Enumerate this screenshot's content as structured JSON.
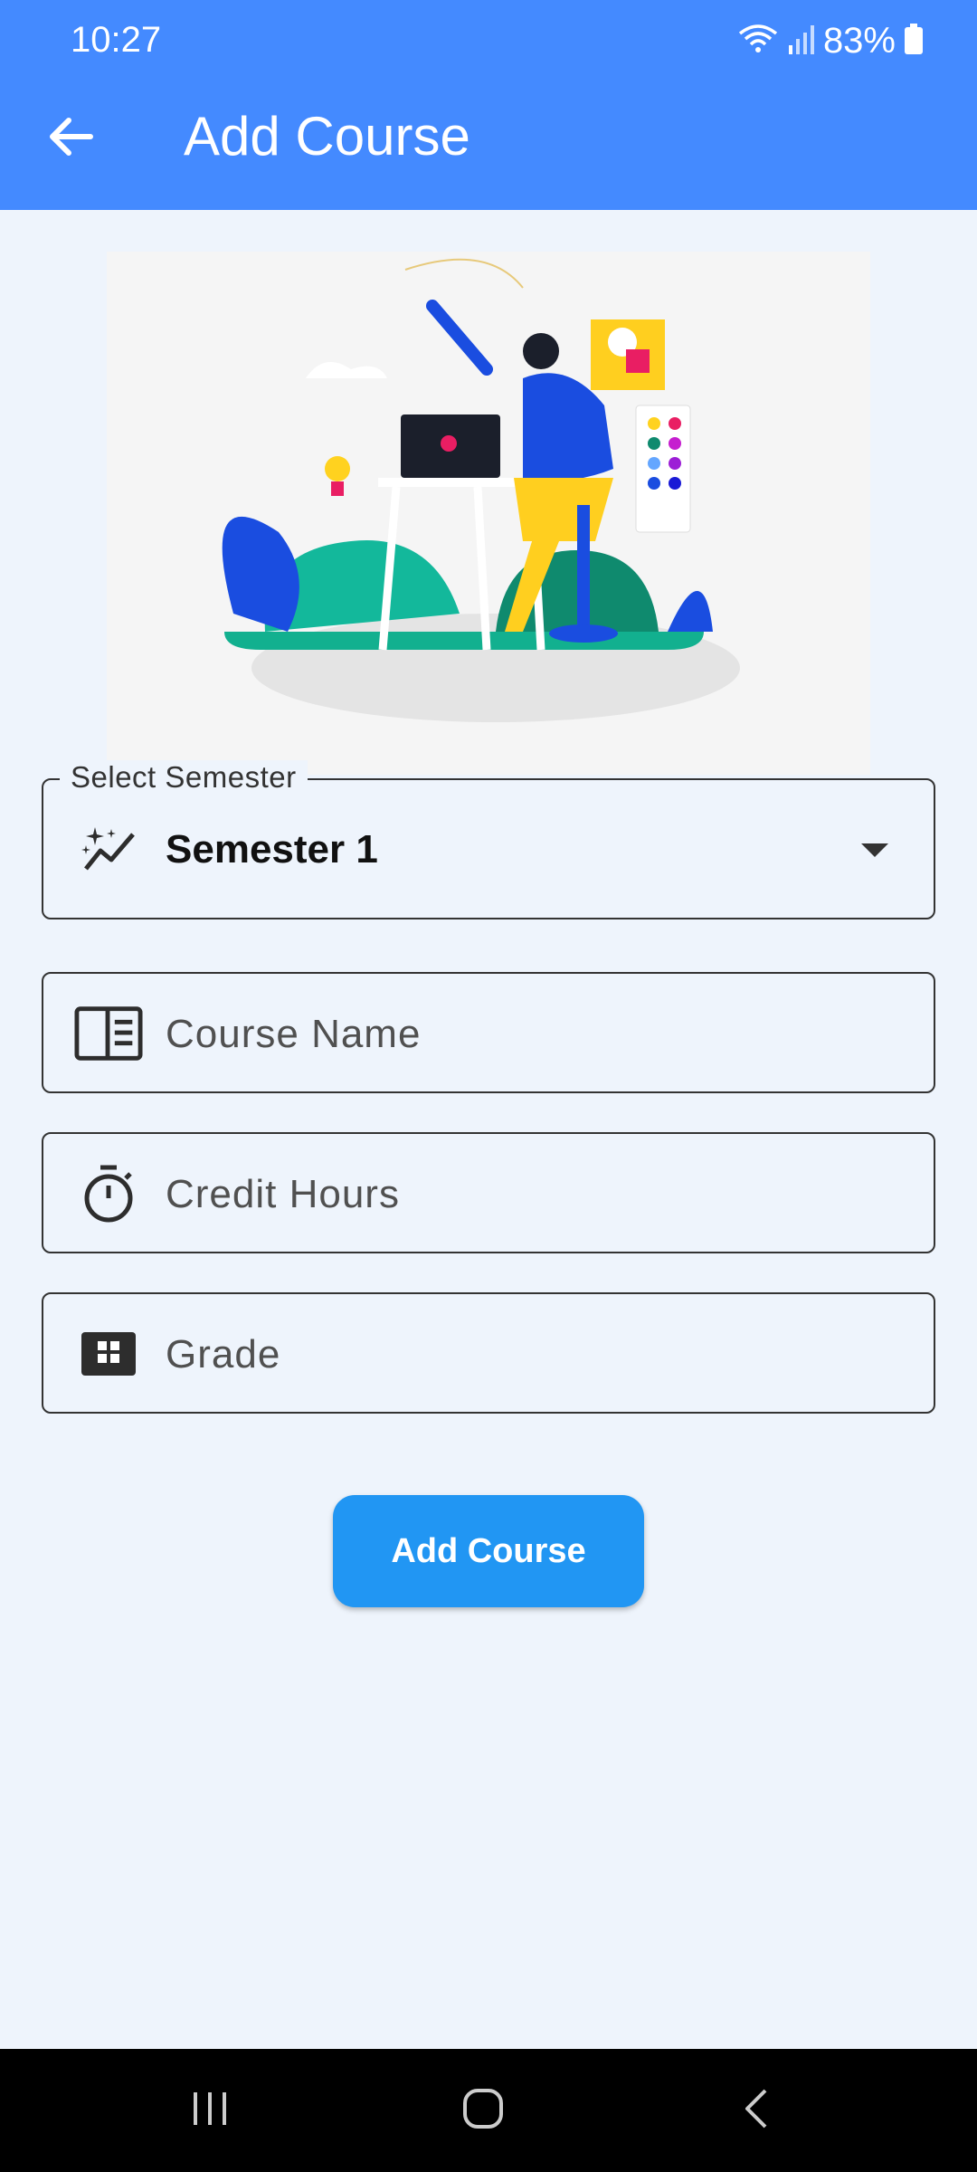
{
  "status": {
    "time": "10:27",
    "battery": "83%"
  },
  "appbar": {
    "title": "Add Course"
  },
  "form": {
    "semester_label": "Select Semester",
    "semester_value": "Semester 1",
    "course_name_placeholder": "Course Name",
    "credit_hours_placeholder": "Credit Hours",
    "grade_placeholder": "Grade"
  },
  "actions": {
    "add_label": "Add Course"
  },
  "icons": {
    "back": "arrow-back-icon",
    "semester": "auto-graph-icon",
    "course": "chrome-reader-mode-icon",
    "credit": "timer-icon",
    "grade": "grid-view-icon",
    "dropdown": "arrow-drop-down-icon"
  },
  "colors": {
    "appbar": "#448aff",
    "button": "#2196f3",
    "background": "#eef4fc"
  }
}
